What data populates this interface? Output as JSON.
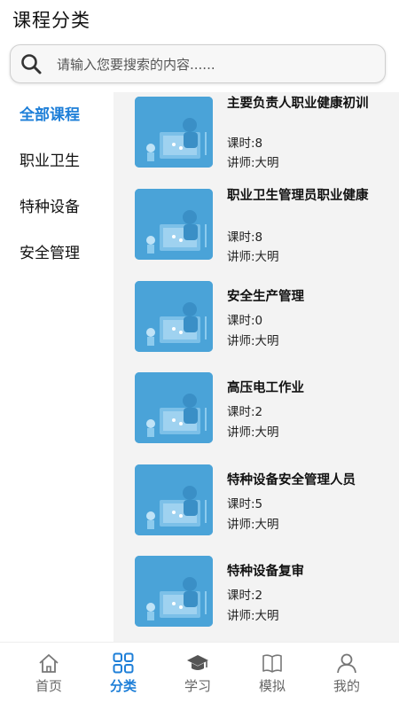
{
  "header": {
    "title": "课程分类"
  },
  "search": {
    "placeholder": "请输入您要搜索的内容......"
  },
  "sidebar": {
    "items": [
      {
        "label": "全部课程",
        "active": true
      },
      {
        "label": "职业卫生",
        "active": false
      },
      {
        "label": "特种设备",
        "active": false
      },
      {
        "label": "安全管理",
        "active": false
      }
    ]
  },
  "courses": [
    {
      "title": "主要负责人职业健康初训",
      "hours": "课时:8",
      "teacher": "讲师:大明"
    },
    {
      "title": "职业卫生管理员职业健康",
      "hours": "课时:8",
      "teacher": "讲师:大明"
    },
    {
      "title": "安全生产管理",
      "hours": "课时:0",
      "teacher": "讲师:大明"
    },
    {
      "title": "高压电工作业",
      "hours": "课时:2",
      "teacher": "讲师:大明"
    },
    {
      "title": "特种设备安全管理人员",
      "hours": "课时:5",
      "teacher": "讲师:大明"
    },
    {
      "title": "特种设备复审",
      "hours": "课时:2",
      "teacher": "讲师:大明"
    }
  ],
  "tabbar": {
    "items": [
      {
        "label": "首页",
        "icon": "home-icon",
        "active": false
      },
      {
        "label": "分类",
        "icon": "grid-icon",
        "active": true
      },
      {
        "label": "学习",
        "icon": "graduation-cap-icon",
        "active": false
      },
      {
        "label": "模拟",
        "icon": "book-icon",
        "active": false
      },
      {
        "label": "我的",
        "icon": "user-icon",
        "active": false
      }
    ]
  },
  "colors": {
    "accent": "#1e7fd8",
    "thumb": "#4aa3d8",
    "content_bg": "#f3f3f3"
  }
}
